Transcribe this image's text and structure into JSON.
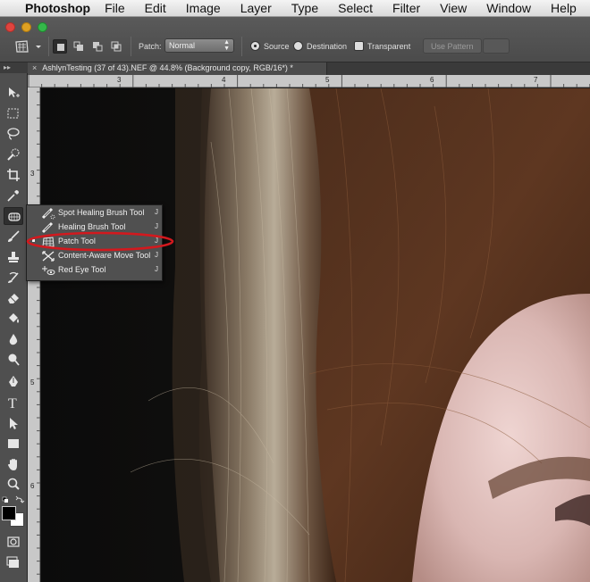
{
  "menubar": {
    "app_name": "Photoshop",
    "items": [
      "File",
      "Edit",
      "Image",
      "Layer",
      "Type",
      "Select",
      "Filter",
      "View",
      "Window",
      "Help"
    ]
  },
  "options_bar": {
    "patch_label": "Patch:",
    "patch_mode": "Normal",
    "source_label": "Source",
    "destination_label": "Destination",
    "transparent_label": "Transparent",
    "use_pattern_label": "Use Pattern",
    "selected_radio": "Source"
  },
  "document": {
    "tab_title": "AshlynTesting (37 of 43).NEF @ 44.8% (Background copy, RGB/16*) *",
    "close_glyph": "×"
  },
  "rulers": {
    "top_labels": [
      "3",
      "4",
      "5",
      "6",
      "7"
    ],
    "left_labels": [
      "3",
      "4",
      "5",
      "6"
    ]
  },
  "toolbar": {
    "grip_glyph": "▸▸",
    "active_tool": "spot-healing-brush",
    "tools": [
      "move",
      "marquee",
      "lasso",
      "quick-selection",
      "crop",
      "eyedropper",
      "spot-healing-brush",
      "brush",
      "clone-stamp",
      "history-brush",
      "eraser",
      "paint-bucket",
      "blur",
      "dodge",
      "pen",
      "type",
      "path-selection",
      "rectangle",
      "hand",
      "zoom"
    ],
    "foreground_color": "#000000",
    "background_color": "#ffffff"
  },
  "flyout": {
    "selected": "Patch Tool",
    "items": [
      {
        "name": "Spot Healing Brush Tool",
        "key": "J",
        "icon": "spot-healing-brush-icon"
      },
      {
        "name": "Healing Brush Tool",
        "key": "J",
        "icon": "healing-brush-icon"
      },
      {
        "name": "Patch Tool",
        "key": "J",
        "icon": "patch-icon"
      },
      {
        "name": "Content-Aware Move Tool",
        "key": "J",
        "icon": "content-aware-move-icon"
      },
      {
        "name": "Red Eye Tool",
        "key": "J",
        "icon": "red-eye-icon"
      }
    ]
  },
  "annotation": {
    "highlight_color": "#d2191e"
  }
}
